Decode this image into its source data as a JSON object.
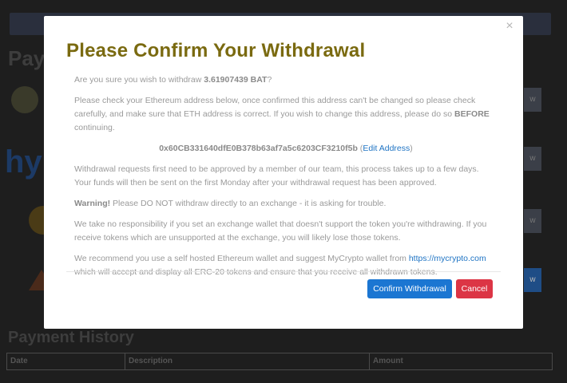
{
  "background": {
    "payments_title": "Paym",
    "logo_text": "hy",
    "button_label": "w",
    "history_title": "Payment History",
    "table_headers": [
      "Date",
      "Description",
      "Amount"
    ]
  },
  "modal": {
    "close_symbol": "×",
    "title": "Please Confirm Your Withdrawal",
    "question_prefix": "Are you sure you wish to withdraw ",
    "amount": "3.61907439 BAT",
    "question_suffix": "?",
    "address_notice_1": "Please check your Ethereum address below, once confirmed this address can't be changed so please check carefully, and make sure that ETH address is correct. If you wish to change this address, please do so ",
    "address_notice_before": "BEFORE",
    "address_notice_2": " continuing.",
    "eth_address": "0x60CB331640dfE0B378b63af7a5c6203CF3210f5b",
    "edit_open": " (",
    "edit_address_label": "Edit Address",
    "edit_close": ")",
    "approval_text": "Withdrawal requests first need to be approved by a member of our team, this process takes up to a few days. Your funds will then be sent on the first Monday after your withdrawal request has been approved.",
    "warning_label": "Warning!",
    "warning_text": " Please DO NOT withdraw directly to an exchange - it is asking for trouble.",
    "responsibility_text": "We take no responsibility if you set an exchange wallet that doesn't support the token you're withdrawing. If you receive tokens which are unsupported at the exchange, you will likely lose those tokens.",
    "recommend_prefix": "We recommend you use a self hosted Ethereum wallet and suggest MyCrypto wallet from ",
    "recommend_link": "https://mycrypto.com",
    "recommend_suffix": " which will accept and display all ERC-20 tokens and ensure that you receive all withdrawn tokens.",
    "confirm_label": "Confirm Withdrawal",
    "cancel_label": "Cancel"
  },
  "colors": {
    "title": "#7a6a10",
    "link": "#1f74c4",
    "confirm": "#1b76d2",
    "cancel": "#dc3545",
    "overlay": "#1e1e1e"
  }
}
